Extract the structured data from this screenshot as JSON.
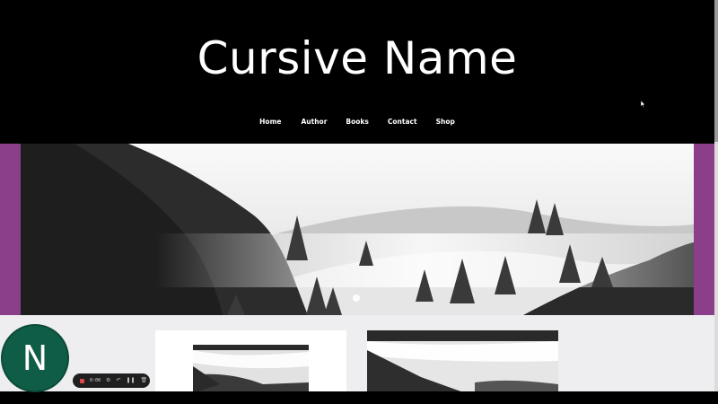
{
  "site": {
    "title": "Cursive Name",
    "nav": [
      "Home",
      "Author",
      "Books",
      "Contact",
      "Shop"
    ]
  },
  "colors": {
    "header_bg": "#000000",
    "hero_frame": "#8b3f8b",
    "page_bg": "#eeeef0",
    "avatar_bg": "#0f5d47"
  },
  "hero": {
    "image": "misty forested hillside, black and white"
  },
  "cards": [
    {
      "image": "misty valley with trees"
    },
    {
      "image": "misty valley with trees"
    }
  ],
  "avatar": {
    "letter": "N"
  },
  "recorder": {
    "time": "0:00",
    "icons": [
      "stop-icon",
      "settings-icon",
      "undo-icon",
      "pause-icon",
      "trash-icon"
    ]
  }
}
